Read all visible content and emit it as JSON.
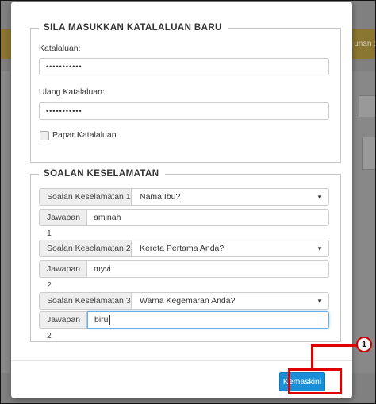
{
  "background": {
    "topbar_text": "unan :"
  },
  "password_section": {
    "legend": "SILA MASUKKAN KATALALUAN BARU",
    "password_label": "Katalaluan:",
    "password_value": "•••••••••••",
    "confirm_label": "Ulang Katalaluan:",
    "confirm_value": "•••••••••••",
    "show_password_label": "Papar Katalaluan"
  },
  "security_section": {
    "legend": "SOALAN KESELAMATAN",
    "items": [
      {
        "question_label": "Soalan Keselamatan 1",
        "question_value": "Nama Ibu?",
        "answer_label": "Jawapan 1",
        "answer_value": "aminah"
      },
      {
        "question_label": "Soalan Keselamatan 2",
        "question_value": "Kereta Pertama Anda?",
        "answer_label": "Jawapan 2",
        "answer_value": "myvi"
      },
      {
        "question_label": "Soalan Keselamatan 3",
        "question_value": "Warna Kegemaran Anda?",
        "answer_label": "Jawapan 2",
        "answer_value": "biru"
      }
    ]
  },
  "footer": {
    "update_button": "Kemaskini"
  },
  "annotation": {
    "step_number": "1",
    "color": "#e00000"
  },
  "colors": {
    "primary_button": "#1a8fd8",
    "focus_border": "#66afe9"
  }
}
